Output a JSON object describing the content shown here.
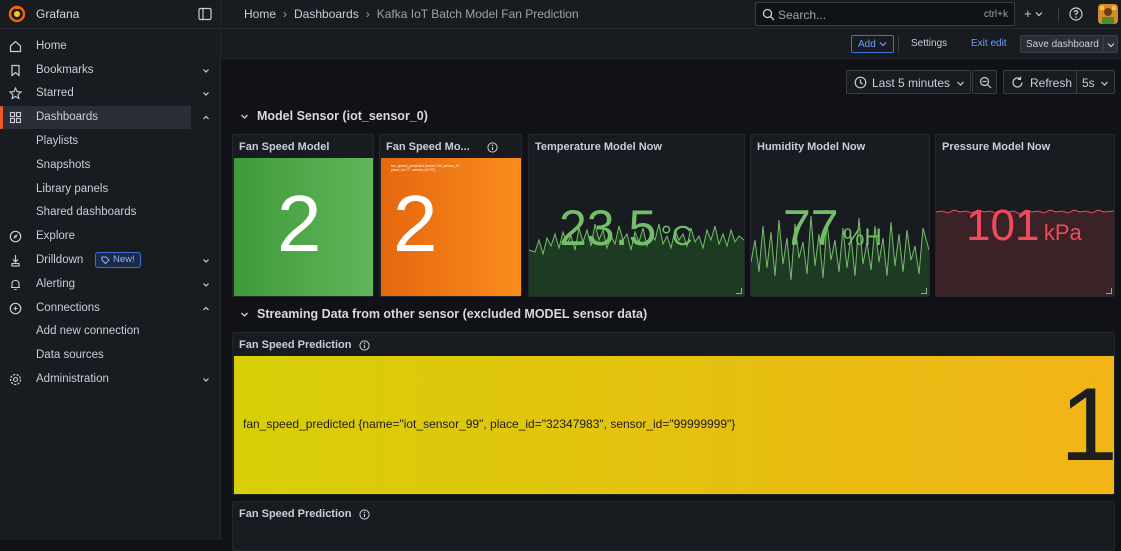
{
  "app": {
    "title": "Grafana"
  },
  "breadcrumb": {
    "home": "Home",
    "dashboards": "Dashboards",
    "current": "Kafka IoT Batch Model Fan Prediction"
  },
  "search": {
    "placeholder": "Search...",
    "shortcut": "ctrl+k"
  },
  "sidebar": {
    "home": "Home",
    "bookmarks": "Bookmarks",
    "starred": "Starred",
    "dashboards": "Dashboards",
    "dashboards_children": [
      "Playlists",
      "Snapshots",
      "Library panels",
      "Shared dashboards"
    ],
    "explore": "Explore",
    "drilldown": "Drilldown",
    "drilldown_badge": "New!",
    "alerting": "Alerting",
    "connections": "Connections",
    "connections_children": [
      "Add new connection",
      "Data sources"
    ],
    "administration": "Administration"
  },
  "toolbar": {
    "add": "Add",
    "settings": "Settings",
    "exit_edit": "Exit edit",
    "save": "Save dashboard"
  },
  "time": {
    "range": "Last 5 minutes",
    "refresh": "Refresh",
    "interval": "5s"
  },
  "rows": [
    {
      "title": "Model Sensor (iot_sensor_0)"
    },
    {
      "title": "Streaming Data from other sensor (excluded MODEL sensor data)"
    }
  ],
  "panels": {
    "fan_speed_model": {
      "title": "Fan Speed Model",
      "value": "2",
      "color": "#56a64b"
    },
    "fan_speed_model_2": {
      "title": "Fan Speed Mo...",
      "value": "2",
      "small_text": "fan_speed_predicted {name=\"iot_sensor_0\", place_id=\"0\", sensor_id=\"0\"}",
      "color": "#f27a10"
    },
    "temperature": {
      "title": "Temperature Model Now",
      "value": "23.5",
      "unit": "°C",
      "color": "#73bf69"
    },
    "humidity": {
      "title": "Humidity Model Now",
      "value": "77",
      "unit": "%H",
      "color": "#73bf69"
    },
    "pressure": {
      "title": "Pressure Model Now",
      "value": "101",
      "unit": "kPa",
      "color": "#f2495c"
    },
    "fan_speed_prediction": {
      "title": "Fan Speed Prediction",
      "series": "fan_speed_predicted {name=\"iot_sensor_99\", place_id=\"32347983\", sensor_id=\"99999999\"}",
      "value": "1",
      "color": "#e0d30c"
    },
    "fan_speed_prediction_2": {
      "title": "Fan Speed Prediction"
    }
  },
  "colors": {
    "accent": "#f05a28",
    "primary": "#3d71d9",
    "bg": "#111217",
    "panel": "#181b1f"
  }
}
